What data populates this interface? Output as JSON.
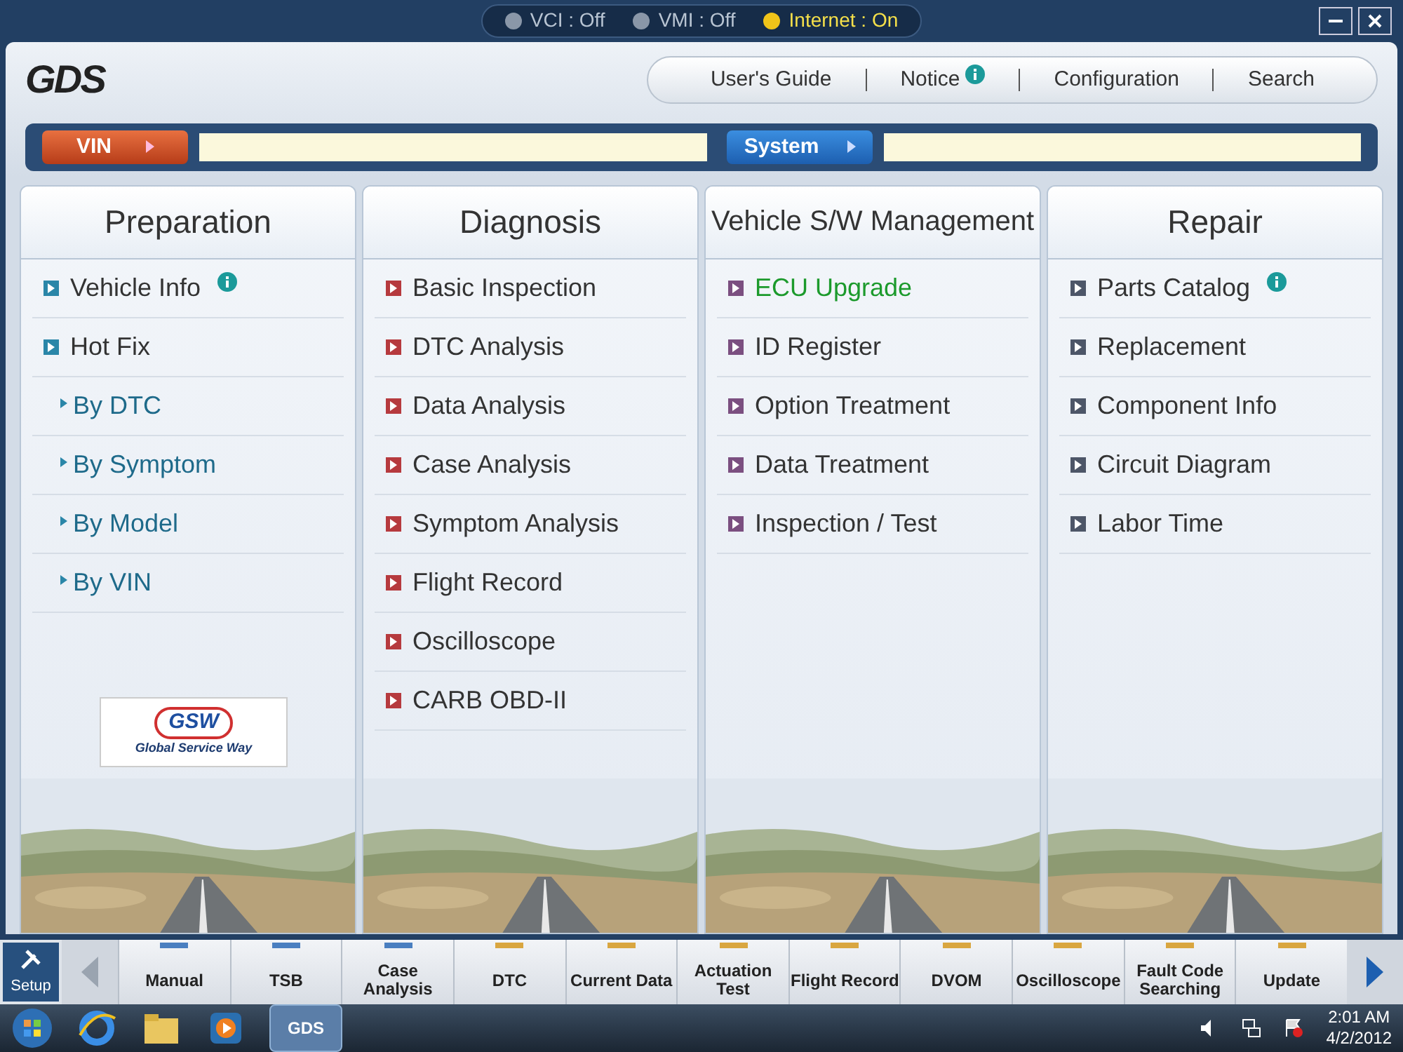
{
  "status": [
    {
      "label": "VCI : Off",
      "on": false
    },
    {
      "label": "VMI : Off",
      "on": false
    },
    {
      "label": "Internet : On",
      "on": true
    }
  ],
  "logo": "GDS",
  "top_links": [
    {
      "label": "User's Guide",
      "info": false
    },
    {
      "label": "Notice",
      "info": true
    },
    {
      "label": "Configuration",
      "info": false
    },
    {
      "label": "Search",
      "info": false
    }
  ],
  "vin": {
    "label": "VIN"
  },
  "system": {
    "label": "System"
  },
  "columns": [
    {
      "title": "Preparation",
      "color": "#2a86a8",
      "items": [
        {
          "kind": "main",
          "label": "Vehicle Info",
          "info": true,
          "highlighted": false
        },
        {
          "kind": "main",
          "label": "Hot Fix",
          "info": false,
          "highlighted": false
        },
        {
          "kind": "sub",
          "label": "By DTC",
          "info": false,
          "highlighted": false
        },
        {
          "kind": "sub",
          "label": "By Symptom",
          "info": false,
          "highlighted": false
        },
        {
          "kind": "sub",
          "label": "By Model",
          "info": false,
          "highlighted": false
        },
        {
          "kind": "sub",
          "label": "By VIN",
          "info": false,
          "highlighted": false
        }
      ],
      "badge": {
        "name": "GSW",
        "tagline": "Global Service Way"
      }
    },
    {
      "title": "Diagnosis",
      "color": "#b63a3e",
      "items": [
        {
          "kind": "main",
          "label": "Basic Inspection",
          "info": false,
          "highlighted": false
        },
        {
          "kind": "main",
          "label": "DTC Analysis",
          "info": false,
          "highlighted": false
        },
        {
          "kind": "main",
          "label": "Data Analysis",
          "info": false,
          "highlighted": false
        },
        {
          "kind": "main",
          "label": "Case Analysis",
          "info": false,
          "highlighted": false
        },
        {
          "kind": "main",
          "label": "Symptom Analysis",
          "info": false,
          "highlighted": false
        },
        {
          "kind": "main",
          "label": "Flight Record",
          "info": false,
          "highlighted": false
        },
        {
          "kind": "main",
          "label": "Oscilloscope",
          "info": false,
          "highlighted": false
        },
        {
          "kind": "main",
          "label": "CARB OBD-II",
          "info": false,
          "highlighted": false
        }
      ]
    },
    {
      "title": "Vehicle S/W Management",
      "color": "#7b4f80",
      "items": [
        {
          "kind": "main",
          "label": "ECU Upgrade",
          "info": false,
          "highlighted": true
        },
        {
          "kind": "main",
          "label": "ID Register",
          "info": false,
          "highlighted": false
        },
        {
          "kind": "main",
          "label": "Option Treatment",
          "info": false,
          "highlighted": false
        },
        {
          "kind": "main",
          "label": "Data Treatment",
          "info": false,
          "highlighted": false
        },
        {
          "kind": "main",
          "label": "Inspection / Test",
          "info": false,
          "highlighted": false
        }
      ]
    },
    {
      "title": "Repair",
      "color": "#4d5668",
      "items": [
        {
          "kind": "main",
          "label": "Parts Catalog",
          "info": true,
          "highlighted": false
        },
        {
          "kind": "main",
          "label": "Replacement",
          "info": false,
          "highlighted": false
        },
        {
          "kind": "main",
          "label": "Component Info",
          "info": false,
          "highlighted": false
        },
        {
          "kind": "main",
          "label": "Circuit Diagram",
          "info": false,
          "highlighted": false
        },
        {
          "kind": "main",
          "label": "Labor Time",
          "info": false,
          "highlighted": false
        }
      ]
    }
  ],
  "setup": {
    "label": "Setup"
  },
  "toolbar": [
    {
      "label": "Manual",
      "color": "#4a7fc0"
    },
    {
      "label": "TSB",
      "color": "#4a7fc0"
    },
    {
      "label": "Case Analysis",
      "color": "#4a7fc0"
    },
    {
      "label": "DTC",
      "color": "#d9a640"
    },
    {
      "label": "Current Data",
      "color": "#d9a640"
    },
    {
      "label": "Actuation Test",
      "color": "#d9a640"
    },
    {
      "label": "Flight Record",
      "color": "#d9a640"
    },
    {
      "label": "DVOM",
      "color": "#d9a640"
    },
    {
      "label": "Oscilloscope",
      "color": "#d9a640"
    },
    {
      "label": "Fault Code Searching",
      "color": "#d9a640"
    },
    {
      "label": "Update",
      "color": "#d9a640"
    }
  ],
  "taskbar": {
    "active_app": "GDS",
    "time": "2:01 AM",
    "date": "4/2/2012"
  }
}
